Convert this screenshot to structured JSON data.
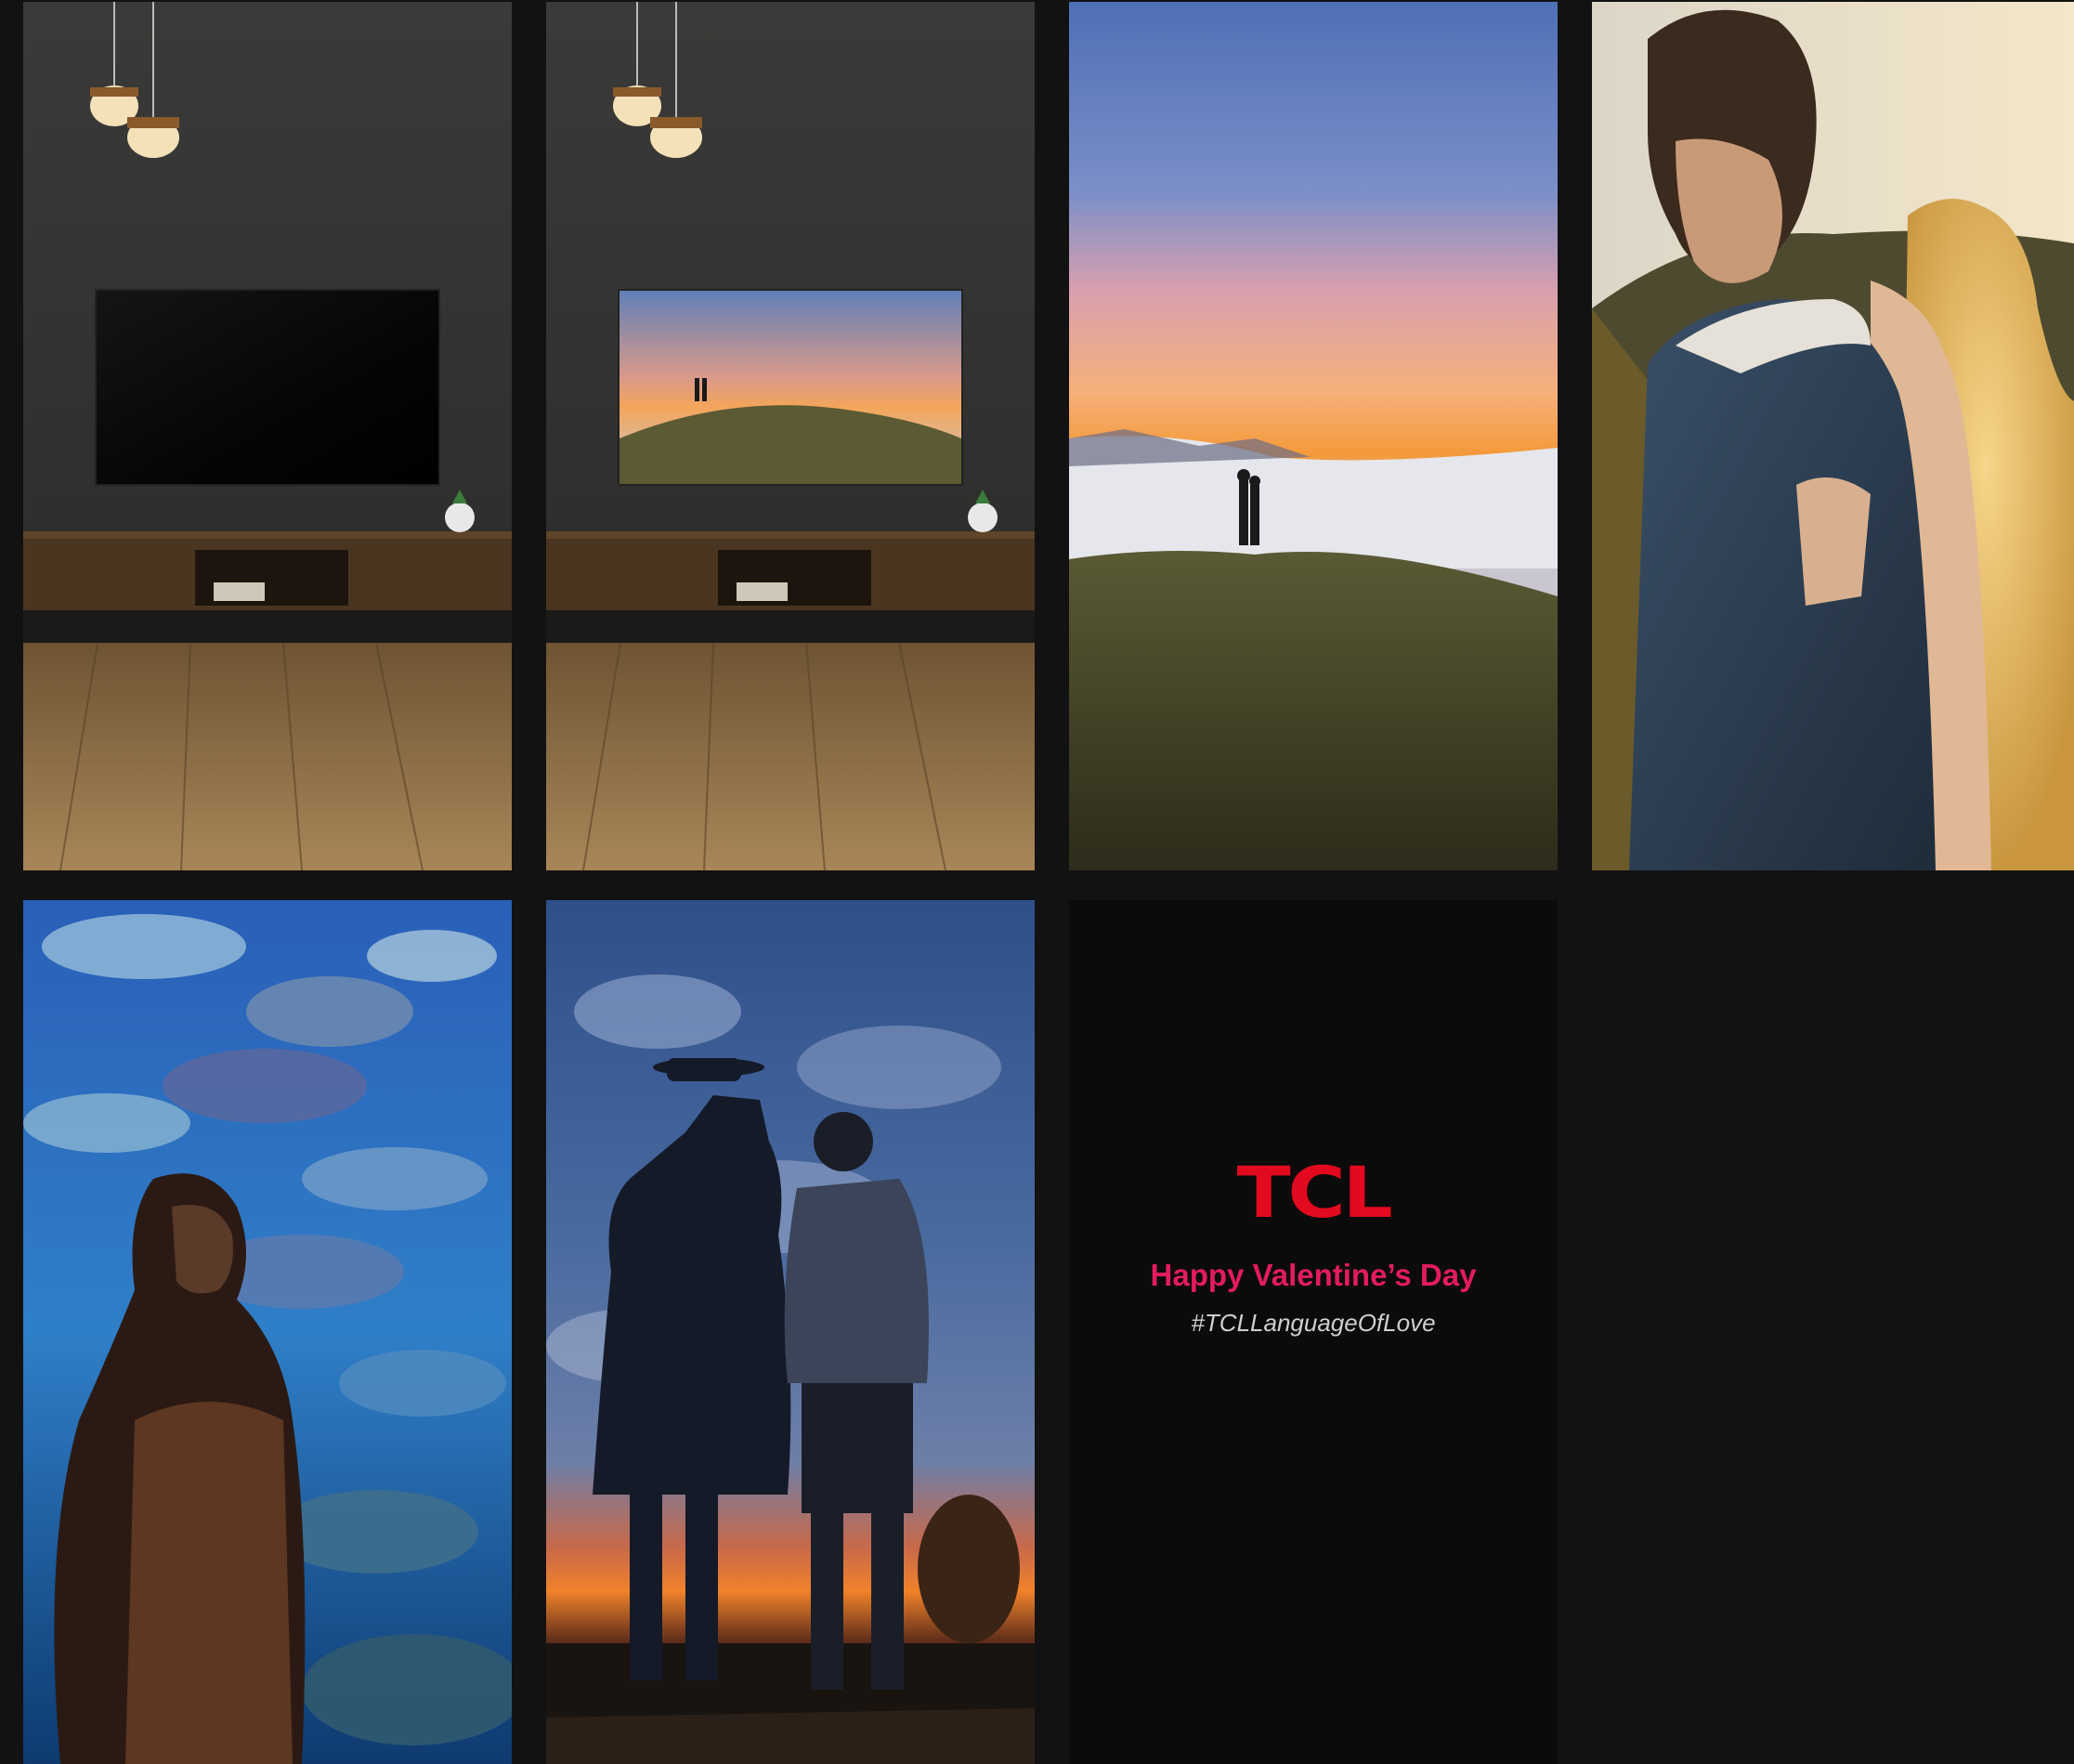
{
  "colors": {
    "page_background": "#121212",
    "tile_background": "#0b0b0b",
    "brand_red": "#e3091e",
    "greeting_pink": "#e31b5f",
    "hashtag_gray": "#cfcfcf"
  },
  "gallery": {
    "tiles": [
      {
        "name": "living-room-tv-off-photo"
      },
      {
        "name": "living-room-tv-on-photo"
      },
      {
        "name": "couple-above-clouds-photo"
      },
      {
        "name": "embracing-couple-sunset-photo"
      },
      {
        "name": "woman-aquarium-photo"
      },
      {
        "name": "couple-silhouette-sunset-photo"
      },
      {
        "name": "valentine-card"
      }
    ]
  },
  "card": {
    "brand": "TCL",
    "greeting": "Happy Valentine’s Day",
    "hashtag": "#TCLLanguageOfLove"
  }
}
